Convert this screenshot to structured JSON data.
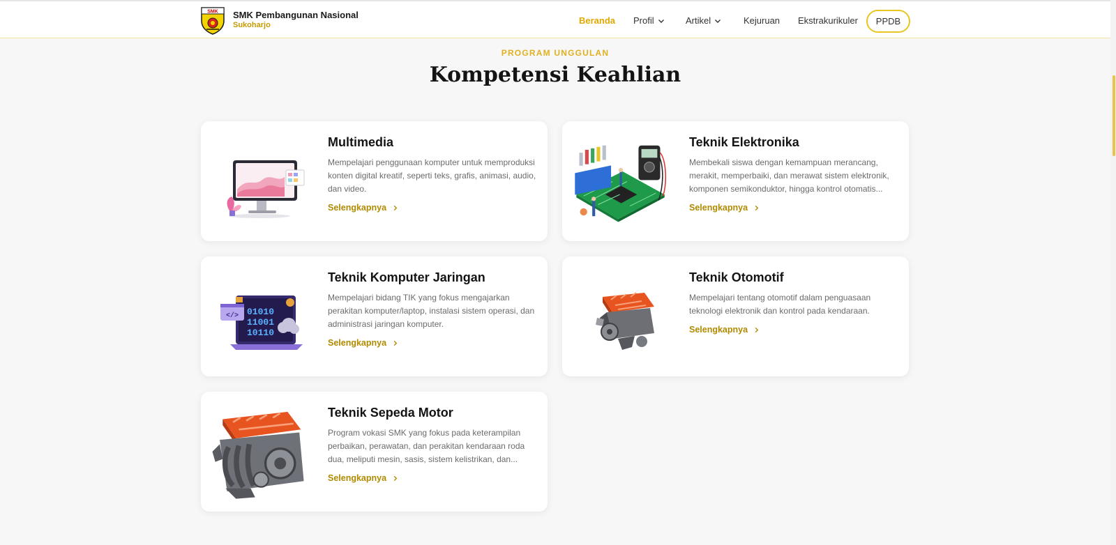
{
  "header": {
    "brand_name": "SMK Pembangunan Nasional",
    "brand_sub": "Sukoharjo",
    "logo_text": "SMK",
    "nav": [
      {
        "label": "Beranda",
        "active": true
      },
      {
        "label": "Profil",
        "dropdown": true
      },
      {
        "label": "Artikel",
        "dropdown": true
      },
      {
        "label": "Kejuruan"
      },
      {
        "label": "Ekstrakurikuler"
      }
    ],
    "cta_label": "PPDB"
  },
  "section": {
    "eyebrow": "PROGRAM UNGGULAN",
    "title": "Kompetensi Keahlian"
  },
  "programs": [
    {
      "title": "Multimedia",
      "description": "Mempelajari penggunaan komputer untuk memproduksi konten digital kreatif, seperti teks, grafis, animasi, audio, dan video.",
      "link": "Selengkapnya",
      "icon": "monitor-illustration"
    },
    {
      "title": "Teknik Elektronika",
      "description": "Membekali siswa dengan kemampuan merancang, merakit, memperbaiki, dan merawat sistem elektronik, komponen semikonduktor, hingga kontrol otomatis...",
      "link": "Selengkapnya",
      "icon": "circuit-board-illustration"
    },
    {
      "title": "Teknik Komputer Jaringan",
      "description": "Mempelajari bidang TIK yang fokus mengajarkan perakitan komputer/laptop, instalasi sistem operasi, dan administrasi jaringan komputer.",
      "link": "Selengkapnya",
      "icon": "laptop-binary-illustration",
      "binary": [
        "01010",
        "11001",
        "10110"
      ]
    },
    {
      "title": "Teknik Otomotif",
      "description": "Mempelajari tentang otomotif dalam penguasaan teknologi elektronik dan kontrol pada kendaraan.",
      "link": "Selengkapnya",
      "icon": "car-engine-illustration"
    },
    {
      "title": "Teknik Sepeda Motor",
      "description": "Program vokasi SMK yang fokus pada keterampilan perbaikan, perawatan, dan perakitan kendaraan roda dua, meliputi mesin, sasis, sistem kelistrikan, dan...",
      "link": "Selengkapnya",
      "icon": "motor-engine-illustration"
    }
  ],
  "colors": {
    "accent": "#e0a800",
    "link": "#b08a00",
    "background": "#f7f7f8"
  }
}
